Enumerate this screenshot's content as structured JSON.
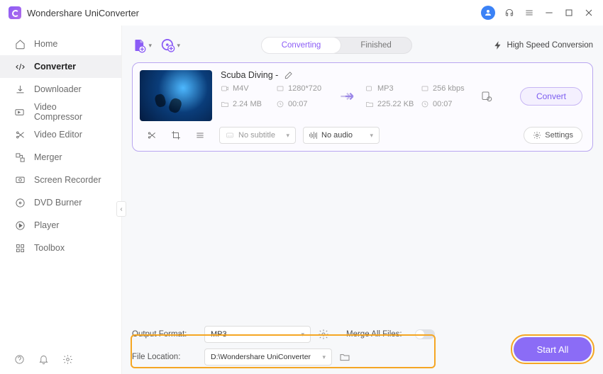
{
  "app": {
    "title": "Wondershare UniConverter"
  },
  "sidebar": {
    "items": [
      {
        "label": "Home"
      },
      {
        "label": "Converter"
      },
      {
        "label": "Downloader"
      },
      {
        "label": "Video Compressor"
      },
      {
        "label": "Video Editor"
      },
      {
        "label": "Merger"
      },
      {
        "label": "Screen Recorder"
      },
      {
        "label": "DVD Burner"
      },
      {
        "label": "Player"
      },
      {
        "label": "Toolbox"
      }
    ]
  },
  "tabs": {
    "converting": "Converting",
    "finished": "Finished"
  },
  "high_speed": "High Speed Conversion",
  "item": {
    "title": "Scuba Diving - ",
    "src": {
      "format": "M4V",
      "size": "2.24 MB",
      "res": "1280*720",
      "duration": "00:07"
    },
    "dst": {
      "format": "MP3",
      "size": "225.22 KB",
      "bitrate": "256 kbps",
      "duration": "00:07"
    },
    "subtitle": "No subtitle",
    "audio": "No audio",
    "settings": "Settings",
    "convert": "Convert"
  },
  "footer": {
    "output_format_label": "Output Format:",
    "output_format": "MP3",
    "file_location_label": "File Location:",
    "file_location": "D:\\Wondershare UniConverter",
    "merge_label": "Merge All Files:",
    "start_all": "Start All"
  }
}
